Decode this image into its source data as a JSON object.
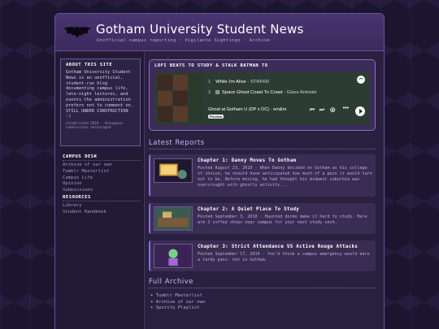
{
  "site": {
    "title": "Gotham University Student News",
    "subtitle": "Unofficial campus reporting · Vigilante Sightings · Archive"
  },
  "sidebar": {
    "about_title": "ABOUT THIS SITE",
    "about_text": "Gotham University Student News is an unofficial, student-run blog documenting campus life, late-night lectures, and events the administration prefers not to comment on.",
    "about_status": "STILL UNDER CONSTRUCTION :)",
    "about_footer": "established 2010 · Anonymous submissions encouraged",
    "campus_desk_heading": "CAMPUS DESK",
    "campus_desk_links": [
      "Archive of our own",
      "Tumblr Masterlist",
      "Campus Life",
      "Opinion",
      "Submissions"
    ],
    "resources_heading": "RESOURCES",
    "resources_links": [
      "Library",
      "Student Handbook"
    ]
  },
  "player": {
    "heading": "LOFI BEATS TO STUDY & STALK BATMAN TO",
    "tracks": [
      {
        "num": "1",
        "title": "While I'm Alive",
        "artist": "STRFKR",
        "explicit": false
      },
      {
        "num": "2",
        "title": "Space Ghost Coast To Coast",
        "artist": "Glass Animals",
        "explicit": true
      }
    ],
    "explicit_label": "E",
    "now_playing": "Ghost at Gotham U (DP x DC) · em&m",
    "preview_label": "Preview",
    "icons": [
      "spotify-icon",
      "skip-back-icon",
      "skip-forward-icon",
      "add-icon",
      "more-icon",
      "play-icon"
    ]
  },
  "latest": {
    "heading": "Latest Reports",
    "posts": [
      {
        "title": "Chapter 1: Danny Moves To Gotham",
        "text": "Posted August 23, 2010 · When Danny decided on Gotham as his college of choice, he should have anticipated how much of a pain it would turn out to be. Before moving, he had thought his midwest suburbia was overcrought with ghostly activity..."
      },
      {
        "title": "Chapter 2: A Quiet Place To Study",
        "text": "Posted September 3, 2010 · Haunted dorms make it hard to study. Here are 3 coffee shops near campus for your next study sesh."
      },
      {
        "title": "Chapter 3: Strict Attendance VS Active Rouge Attacks",
        "text": "Posted September 17, 2010 · You'd think a campus emergency would earn a tardy pass- not in Gotham."
      }
    ]
  },
  "archive": {
    "heading": "Full Archive",
    "links": [
      "Tumblr Masterlist",
      "Archive of our own",
      "Spotify Playlist"
    ]
  },
  "colors": {
    "accent": "#8a6fd0",
    "background": "#1c1530",
    "panel": "#2a2040",
    "player_bg": "#2c3b34"
  }
}
